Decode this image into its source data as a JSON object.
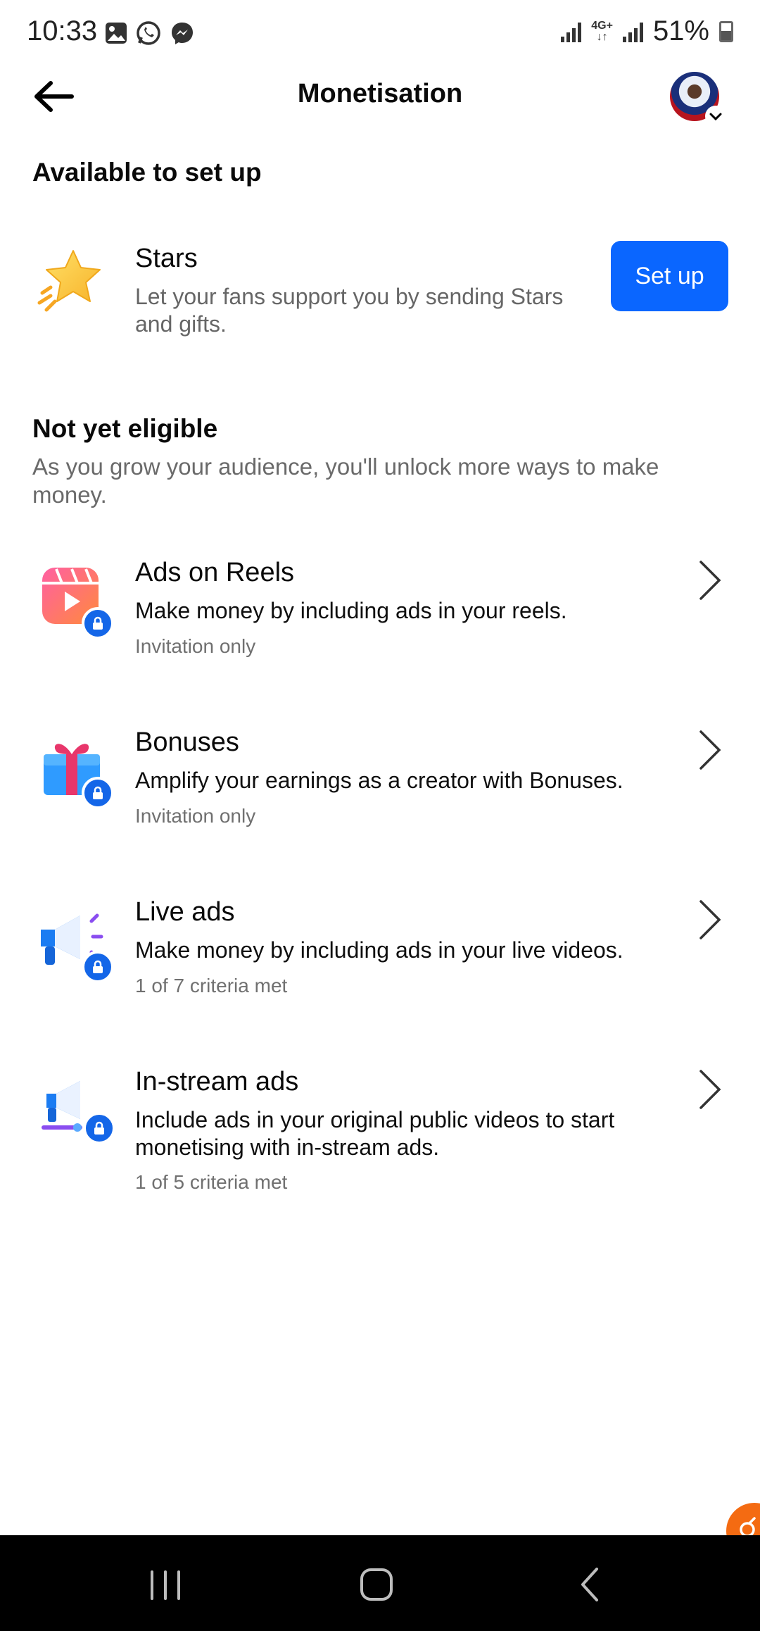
{
  "status_bar": {
    "time": "10:33",
    "network": "4G+",
    "battery": "51%"
  },
  "header": {
    "title": "Monetisation"
  },
  "available": {
    "heading": "Available to set up",
    "items": [
      {
        "title": "Stars",
        "description": "Let your fans support you by sending Stars and gifts.",
        "button_label": "Set up",
        "icon": "star-icon"
      }
    ]
  },
  "not_eligible": {
    "heading": "Not yet eligible",
    "description": "As you grow your audience, you'll unlock more ways to make money.",
    "items": [
      {
        "title": "Ads on Reels",
        "description": "Make money by including ads in your reels.",
        "meta": "Invitation only",
        "icon": "reels-icon"
      },
      {
        "title": "Bonuses",
        "description": "Amplify your earnings as a creator with Bonuses.",
        "meta": "Invitation only",
        "icon": "gift-icon"
      },
      {
        "title": "Live ads",
        "description": "Make money by including ads in your live videos.",
        "meta": "1 of 7 criteria met",
        "icon": "megaphone-icon"
      },
      {
        "title": "In-stream ads",
        "description": "Include ads in your original public videos to start monetising with in-stream ads.",
        "meta": "1 of 5 criteria met",
        "icon": "instream-megaphone-icon"
      }
    ]
  },
  "colors": {
    "accent": "#0a66ff",
    "lock": "#1466e8"
  }
}
